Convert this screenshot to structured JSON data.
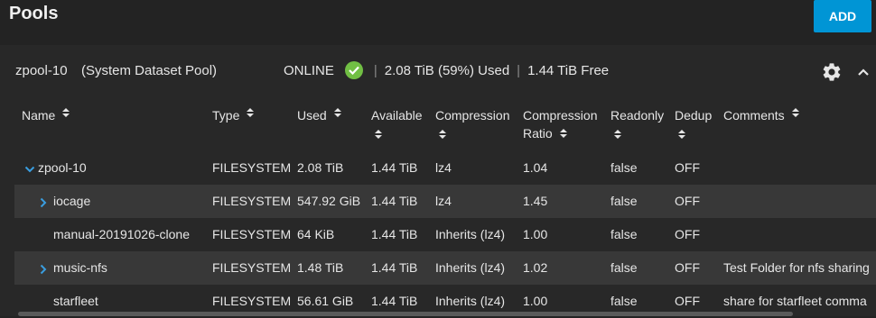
{
  "header": {
    "title": "Pools",
    "add_label": "ADD"
  },
  "pool": {
    "name": "zpool-10",
    "description": "(System Dataset Pool)",
    "status": "ONLINE",
    "used": "2.08 TiB (59%) Used",
    "free": "1.44 TiB Free",
    "separator": "|"
  },
  "table": {
    "columns": {
      "name": "Name",
      "type": "Type",
      "used": "Used",
      "available": "Available",
      "compression": "Compression",
      "compression_ratio_1": "Compression",
      "compression_ratio_2": "Ratio",
      "readonly": "Readonly",
      "dedup": "Dedup",
      "comments": "Comments"
    },
    "rows": [
      {
        "name": "zpool-10",
        "type": "FILESYSTEM",
        "used": "2.08 TiB",
        "available": "1.44 TiB",
        "compression": "lz4",
        "ratio": "1.04",
        "readonly": "false",
        "dedup": "OFF",
        "comments": ""
      },
      {
        "name": "iocage",
        "type": "FILESYSTEM",
        "used": "547.92 GiB",
        "available": "1.44 TiB",
        "compression": "lz4",
        "ratio": "1.45",
        "readonly": "false",
        "dedup": "OFF",
        "comments": ""
      },
      {
        "name": "manual-20191026-clone",
        "type": "FILESYSTEM",
        "used": "64 KiB",
        "available": "1.44 TiB",
        "compression": "Inherits (lz4)",
        "ratio": "1.00",
        "readonly": "false",
        "dedup": "OFF",
        "comments": ""
      },
      {
        "name": "music-nfs",
        "type": "FILESYSTEM",
        "used": "1.48 TiB",
        "available": "1.44 TiB",
        "compression": "Inherits (lz4)",
        "ratio": "1.02",
        "readonly": "false",
        "dedup": "OFF",
        "comments": "Test Folder for nfs sharing"
      },
      {
        "name": "starfleet",
        "type": "FILESYSTEM",
        "used": "56.61 GiB",
        "available": "1.44 TiB",
        "compression": "Inherits (lz4)",
        "ratio": "1.00",
        "readonly": "false",
        "dedup": "OFF",
        "comments": "share for starfleet comma"
      }
    ]
  },
  "colors": {
    "accent": "#0095d5",
    "status_ok": "#71bf44",
    "background": "#232323",
    "row_alt": "#383838",
    "expander": "#3a9ee0"
  },
  "icons": {
    "status": "check-circle-icon",
    "settings": "gear-icon",
    "collapse": "chevron-up-icon",
    "sort": "sort-icon",
    "expand": "chevron-right-icon",
    "collapse_row": "chevron-down-icon"
  }
}
